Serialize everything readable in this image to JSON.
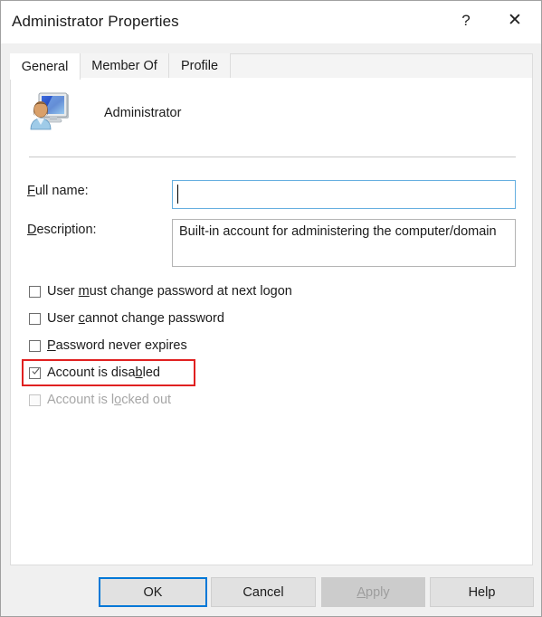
{
  "window": {
    "title": "Administrator Properties",
    "help_button": "?",
    "close_button": "✕",
    "help_icon_name": "help-question-icon",
    "close_icon_name": "close-x-icon"
  },
  "tabs": [
    {
      "label": "General",
      "selected": true
    },
    {
      "label": "Member Of",
      "selected": false
    },
    {
      "label": "Profile",
      "selected": false
    }
  ],
  "account": {
    "icon_name": "user-account-icon",
    "name": "Administrator"
  },
  "fields": [
    {
      "label_prefix": "",
      "label_accel": "F",
      "label_suffix": "ull name:",
      "value": "",
      "focused": true
    },
    {
      "label_prefix": "",
      "label_accel": "D",
      "label_suffix": "escription:",
      "value": "Built-in account for administering the computer/domain",
      "focused": false
    }
  ],
  "checkboxes": [
    {
      "prefix": "User ",
      "accel": "m",
      "suffix": "ust change password at next logon",
      "checked": false,
      "disabled": false,
      "highlighted": false
    },
    {
      "prefix": "User ",
      "accel": "c",
      "suffix": "annot change password",
      "checked": false,
      "disabled": false,
      "highlighted": false
    },
    {
      "prefix": "",
      "accel": "P",
      "suffix": "assword never expires",
      "checked": false,
      "disabled": false,
      "highlighted": false
    },
    {
      "prefix": "Account is disa",
      "accel": "b",
      "suffix": "led",
      "checked": true,
      "disabled": false,
      "highlighted": true
    },
    {
      "prefix": "Account is l",
      "accel": "o",
      "suffix": "cked out",
      "checked": false,
      "disabled": true,
      "highlighted": false
    }
  ],
  "buttons": [
    {
      "label": "OK",
      "accel": "",
      "state": "default"
    },
    {
      "label": "Cancel",
      "accel": "",
      "state": "normal"
    },
    {
      "label": "Apply",
      "accel": "A",
      "state": "disabled"
    },
    {
      "label": "Help",
      "accel": "",
      "state": "normal"
    }
  ],
  "colors": {
    "accent": "#0078d7",
    "focus_border": "#66afe0",
    "highlight": "#e02020",
    "dialog_bg": "#f0f0f0",
    "panel_bg": "#ffffff"
  }
}
